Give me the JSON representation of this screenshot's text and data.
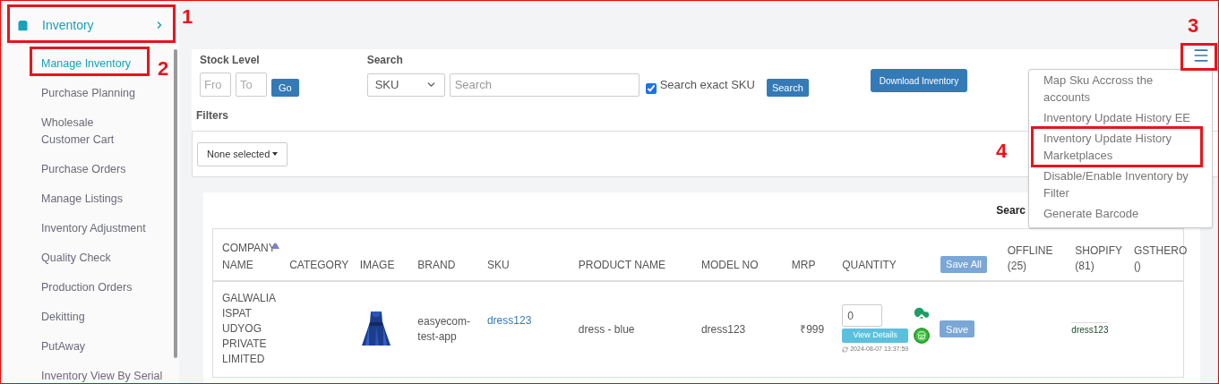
{
  "sidebar": {
    "section": {
      "label": "Inventory",
      "expanded": true
    },
    "items": [
      {
        "label": "Manage Inventory",
        "selected": true
      },
      {
        "label": "Purchase Planning",
        "selected": false
      },
      {
        "label": "Wholesale Customer Cart",
        "selected": false
      },
      {
        "label": "Purchase Orders",
        "selected": false
      },
      {
        "label": "Manage Listings",
        "selected": false
      },
      {
        "label": "Inventory Adjustment",
        "selected": false
      },
      {
        "label": "Quality Check",
        "selected": false
      },
      {
        "label": "Production Orders",
        "selected": false
      },
      {
        "label": "Dekitting",
        "selected": false
      },
      {
        "label": "PutAway",
        "selected": false
      },
      {
        "label": "Inventory View By Serial",
        "selected": false
      }
    ]
  },
  "stock_level": {
    "label": "Stock Level",
    "from_placeholder": "Fro",
    "to_placeholder": "To",
    "button": "Go"
  },
  "search": {
    "label": "Search",
    "field_type": "SKU",
    "placeholder": "Search",
    "exact_sku": {
      "label": "Search exact SKU",
      "checked": true
    },
    "button": "Search"
  },
  "download_button": "Download Inventory",
  "filters": {
    "label": "Filters",
    "dropdown": "None selected"
  },
  "menu": {
    "open": true,
    "items": [
      "Map Sku Accross the accounts",
      "Inventory Update History EE",
      "Inventory Update History Marketplaces",
      "Disable/Enable Inventory by Filter",
      "Generate Barcode"
    ]
  },
  "table": {
    "search_label": "Searc",
    "save_all": "Save All",
    "columns": [
      "COMPANY NAME",
      "CATEGORY",
      "IMAGE",
      "BRAND",
      "SKU",
      "PRODUCT NAME",
      "MODEL NO",
      "MRP",
      "QUANTITY",
      "OFFLINE (25)",
      "SHOPIFY (81)",
      "GSTHERO ()"
    ],
    "rows": [
      {
        "company": "GALWALIA ISPAT UDYOG PRIVATE LIMITED",
        "category": "",
        "brand": "easyecom-test-app",
        "sku": "dress123",
        "product_name": "dress - blue",
        "model_no": "dress123",
        "mrp": "₹999",
        "quantity": "0",
        "view_details": "View Details",
        "updated": "2024-08-07 13:37:59",
        "save": "Save",
        "shopify": "dress123"
      }
    ]
  },
  "annotations": [
    {
      "label": "1"
    },
    {
      "label": "2"
    },
    {
      "label": "3"
    },
    {
      "label": "4"
    }
  ]
}
